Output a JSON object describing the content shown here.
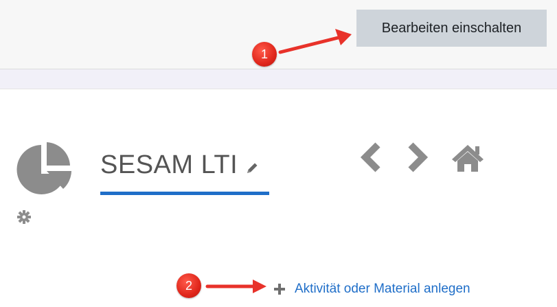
{
  "toolbar": {
    "edit_mode_label": "Bearbeiten einschalten"
  },
  "course": {
    "title": "SESAM LTI"
  },
  "actions": {
    "add_activity_label": "Aktivität oder Material anlegen"
  },
  "annotations": {
    "badge_1": "1",
    "badge_2": "2"
  },
  "colors": {
    "accent": "#1f6ec8",
    "badge": "#e0261b",
    "icon_gray": "#8c8c8c",
    "button_bg": "#ced4da"
  }
}
